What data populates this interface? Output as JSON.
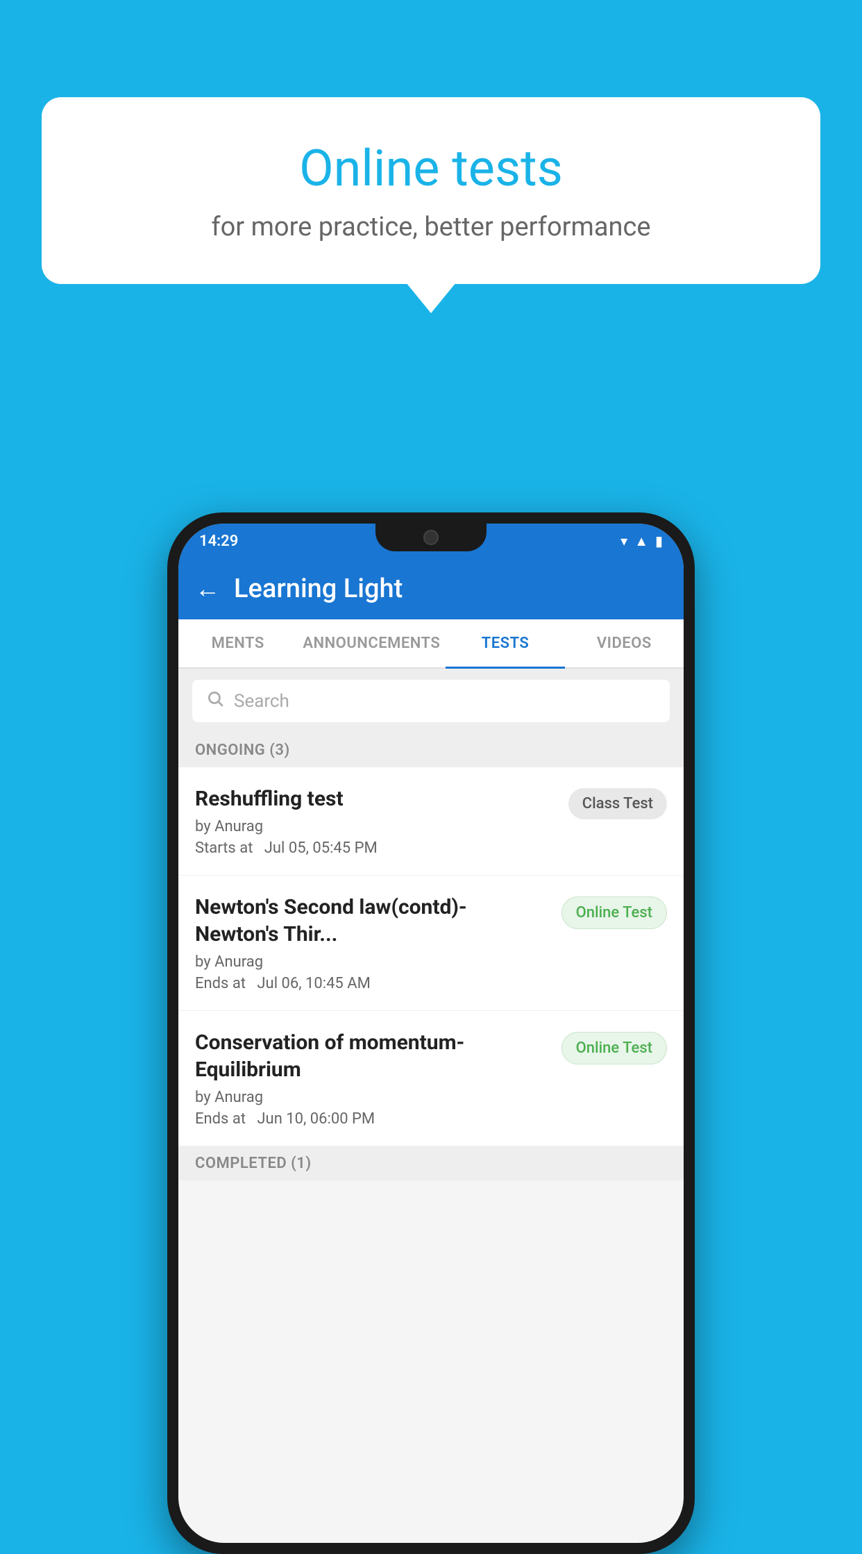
{
  "background_color": "#1ab3e8",
  "speech_bubble": {
    "title": "Online tests",
    "subtitle": "for more practice, better performance"
  },
  "phone": {
    "status_bar": {
      "time": "14:29",
      "icons": [
        "wifi",
        "signal",
        "battery"
      ]
    },
    "header": {
      "title": "Learning Light",
      "back_label": "←"
    },
    "tabs": [
      {
        "label": "MENTS",
        "active": false
      },
      {
        "label": "ANNOUNCEMENTS",
        "active": false
      },
      {
        "label": "TESTS",
        "active": true
      },
      {
        "label": "VIDEOS",
        "active": false
      }
    ],
    "search": {
      "placeholder": "Search"
    },
    "ongoing_section": {
      "label": "ONGOING (3)"
    },
    "tests": [
      {
        "name": "Reshuffling test",
        "author": "by Anurag",
        "time_label": "Starts at",
        "time_value": "Jul 05, 05:45 PM",
        "badge": "Class Test",
        "badge_type": "class"
      },
      {
        "name": "Newton's Second law(contd)-Newton's Thir...",
        "author": "by Anurag",
        "time_label": "Ends at",
        "time_value": "Jul 06, 10:45 AM",
        "badge": "Online Test",
        "badge_type": "online"
      },
      {
        "name": "Conservation of momentum-Equilibrium",
        "author": "by Anurag",
        "time_label": "Ends at",
        "time_value": "Jun 10, 06:00 PM",
        "badge": "Online Test",
        "badge_type": "online"
      }
    ],
    "completed_section": {
      "label": "COMPLETED (1)"
    }
  }
}
